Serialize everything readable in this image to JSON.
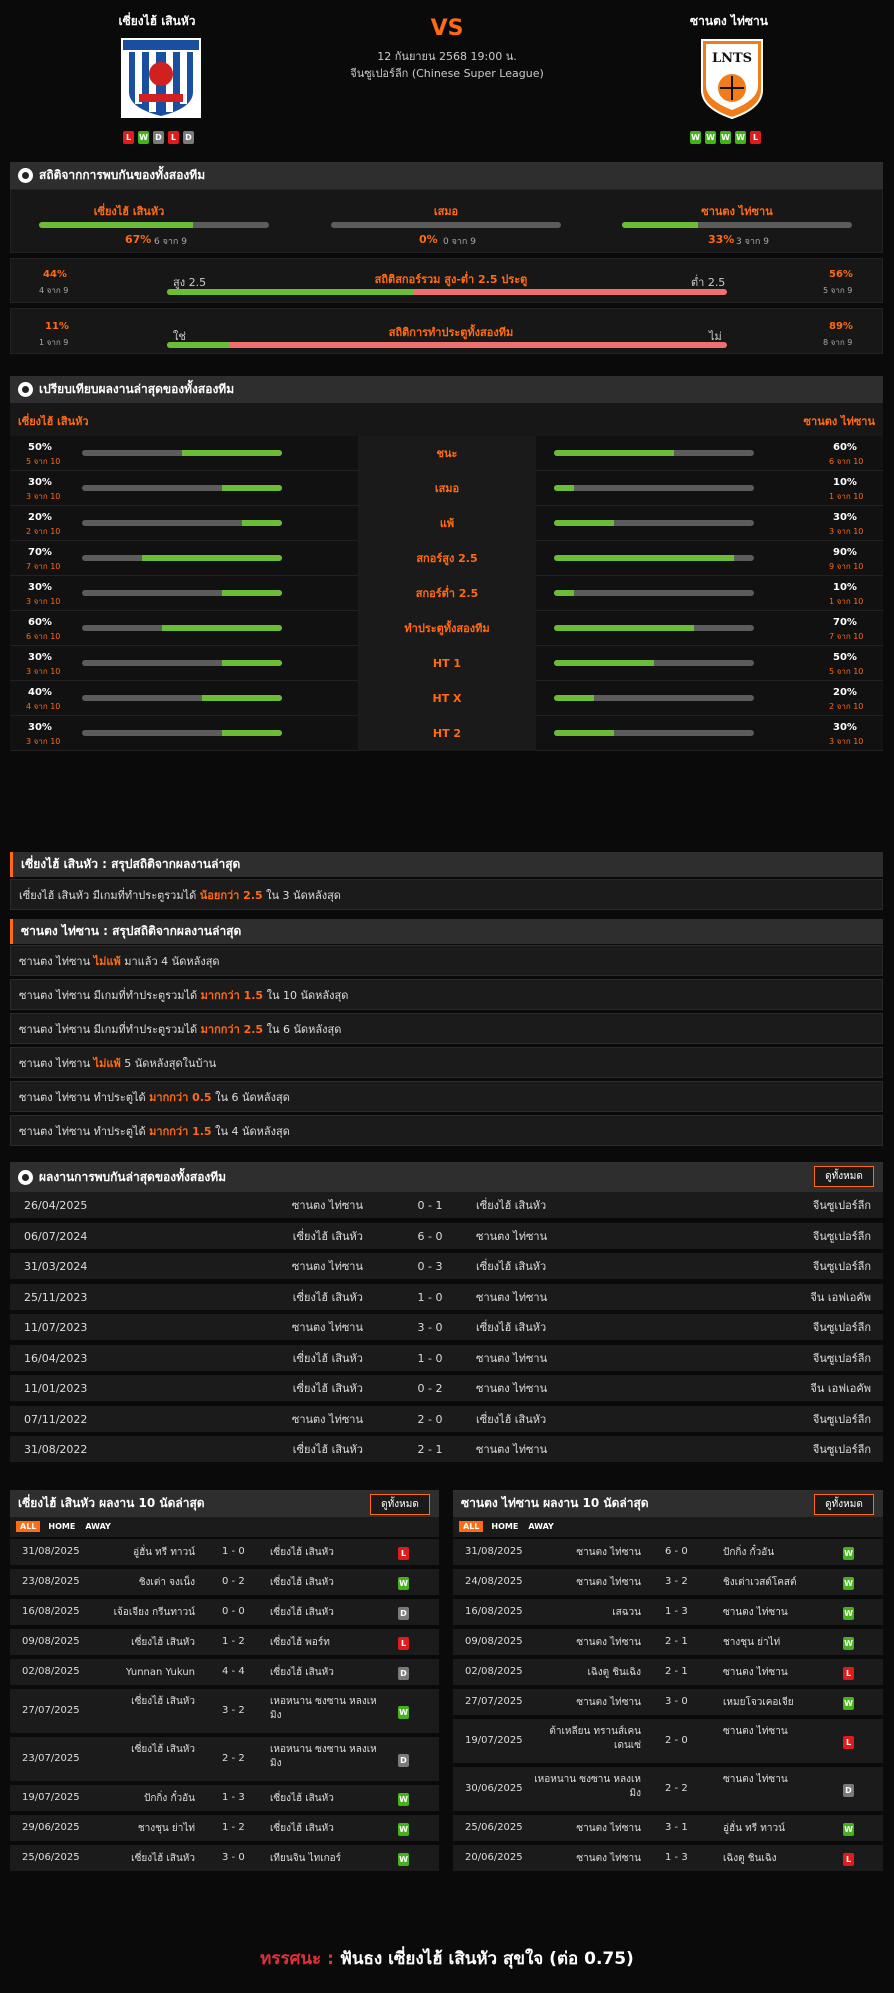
{
  "match": {
    "home": "เซี่ยงไฮ้ เสินหัว",
    "away": "ซานตง ไท่ซาน",
    "vs": "VS",
    "datetime": "12 กันยายน 2568 19:00 น.",
    "league": "จีนซูเปอร์ลีก (Chinese Super League)",
    "home_form": [
      "L",
      "W",
      "D",
      "L",
      "D"
    ],
    "away_form": [
      "W",
      "W",
      "W",
      "W",
      "L"
    ]
  },
  "h2h_stats": {
    "title": "สถิติจากการพบกันของทั้งสองทีม",
    "home_label": "เซี่ยงไฮ้ เสินหัว",
    "home_pct": "67%",
    "home_sub": "6 จาก 9",
    "home_frac": 0.67,
    "draw_label": "เสมอ",
    "draw_pct": "0%",
    "draw_sub": "0 จาก 9",
    "draw_frac": 0,
    "away_label": "ซานตง ไท่ซาน",
    "away_pct": "33%",
    "away_sub": "3 จาก 9",
    "away_frac": 0.33,
    "ou_title": "สถิติสกอร์รวม สูง-ต่ำ 2.5 ประตู",
    "ou_left_pct": "44%",
    "ou_left_sub": "4 จาก 9",
    "ou_left_label": "สูง 2.5",
    "ou_right_pct": "56%",
    "ou_right_sub": "5 จาก 9",
    "ou_right_label": "ต่ำ 2.5",
    "ou_frac": 0.44,
    "bt_title": "สถิติการทำประตูทั้งสองทีม",
    "bt_left_pct": "11%",
    "bt_left_sub": "1 จาก 9",
    "bt_left_label": "ใช่",
    "bt_right_pct": "89%",
    "bt_right_sub": "8 จาก 9",
    "bt_right_label": "ไม่",
    "bt_frac": 0.11
  },
  "compare": {
    "title": "เปรียบเทียบผลงานล่าสุดของทั้งสองทีม",
    "home": "เซี่ยงไฮ้ เสินหัว",
    "away": "ซานตง ไท่ซาน",
    "rows": [
      {
        "label": "ชนะ",
        "hp": "50%",
        "hs": "5 จาก 10",
        "hf": 0.5,
        "ap": "60%",
        "as": "6 จาก 10",
        "af": 0.6
      },
      {
        "label": "เสมอ",
        "hp": "30%",
        "hs": "3 จาก 10",
        "hf": 0.3,
        "ap": "10%",
        "as": "1 จาก 10",
        "af": 0.1
      },
      {
        "label": "แพ้",
        "hp": "20%",
        "hs": "2 จาก 10",
        "hf": 0.2,
        "ap": "30%",
        "as": "3 จาก 10",
        "af": 0.3
      },
      {
        "label": "สกอร์สูง 2.5",
        "hp": "70%",
        "hs": "7 จาก 10",
        "hf": 0.7,
        "ap": "90%",
        "as": "9 จาก 10",
        "af": 0.9
      },
      {
        "label": "สกอร์ต่ำ 2.5",
        "hp": "30%",
        "hs": "3 จาก 10",
        "hf": 0.3,
        "ap": "10%",
        "as": "1 จาก 10",
        "af": 0.1
      },
      {
        "label": "ทำประตูทั้งสองทีม",
        "hp": "60%",
        "hs": "6 จาก 10",
        "hf": 0.6,
        "ap": "70%",
        "as": "7 จาก 10",
        "af": 0.7
      },
      {
        "label": "HT 1",
        "hp": "30%",
        "hs": "3 จาก 10",
        "hf": 0.3,
        "ap": "50%",
        "as": "5 จาก 10",
        "af": 0.5
      },
      {
        "label": "HT X",
        "hp": "40%",
        "hs": "4 จาก 10",
        "hf": 0.4,
        "ap": "20%",
        "as": "2 จาก 10",
        "af": 0.2
      },
      {
        "label": "HT 2",
        "hp": "30%",
        "hs": "3 จาก 10",
        "hf": 0.3,
        "ap": "30%",
        "as": "3 จาก 10",
        "af": 0.3
      }
    ]
  },
  "home_summary": {
    "title": "เซี่ยงไฮ้ เสินหัว : สรุปสถิติจากผลงานล่าสุด",
    "rows": [
      {
        "a": "เซี่ยงไฮ้ เสินหัว  มีเกมที่ทำประตูรวมได้ ",
        "b": "น้อยกว่า  2.5",
        "c": "  ใน 3 นัดหลังสุด"
      }
    ]
  },
  "away_summary": {
    "title": "ซานตง ไท่ซาน : สรุปสถิติจากผลงานล่าสุด",
    "rows": [
      {
        "a": "ซานตง ไท่ซาน ",
        "b": "ไม่แพ้",
        "c": " มาแล้ว 4 นัดหลังสุด"
      },
      {
        "a": "ซานตง ไท่ซาน  มีเกมที่ทำประตูรวมได้ ",
        "b": "มากกว่า  1.5",
        "c": "  ใน 10 นัดหลังสุด"
      },
      {
        "a": "ซานตง ไท่ซาน  มีเกมที่ทำประตูรวมได้ ",
        "b": "มากกว่า  2.5",
        "c": "  ใน 6 นัดหลังสุด"
      },
      {
        "a": "ซานตง ไท่ซาน ",
        "b": "ไม่แพ้",
        "c": "  5  นัดหลังสุดในบ้าน"
      },
      {
        "a": "ซานตง ไท่ซาน  ทำประตูได้ ",
        "b": "มากกว่า  0.5",
        "c": "  ใน 6 นัดหลังสุด"
      },
      {
        "a": "ซานตง ไท่ซาน  ทำประตูได้ ",
        "b": "มากกว่า  1.5",
        "c": "  ใน 4 นัดหลังสุด"
      }
    ]
  },
  "h2h_results": {
    "title": "ผลงานการพบกันล่าสุดของทั้งสองทีม",
    "view_all": "ดูทั้งหมด",
    "rows": [
      {
        "date": "26/04/2025",
        "home": "ซานตง ไท่ซาน",
        "score": "0 - 1",
        "away": "เซี่ยงไฮ้ เสินหัว",
        "comp": "จีนซูเปอร์ลีก"
      },
      {
        "date": "06/07/2024",
        "home": "เซี่ยงไฮ้ เสินหัว",
        "score": "6 - 0",
        "away": "ซานตง ไท่ซาน",
        "comp": "จีนซูเปอร์ลีก"
      },
      {
        "date": "31/03/2024",
        "home": "ซานตง ไท่ซาน",
        "score": "0 - 3",
        "away": "เซี่ยงไฮ้ เสินหัว",
        "comp": "จีนซูเปอร์ลีก"
      },
      {
        "date": "25/11/2023",
        "home": "เซี่ยงไฮ้ เสินหัว",
        "score": "1 - 0",
        "away": "ซานตง ไท่ซาน",
        "comp": "จีน เอฟเอคัพ"
      },
      {
        "date": "11/07/2023",
        "home": "ซานตง ไท่ซาน",
        "score": "3 - 0",
        "away": "เซี่ยงไฮ้ เสินหัว",
        "comp": "จีนซูเปอร์ลีก"
      },
      {
        "date": "16/04/2023",
        "home": "เซี่ยงไฮ้ เสินหัว",
        "score": "1 - 0",
        "away": "ซานตง ไท่ซาน",
        "comp": "จีนซูเปอร์ลีก"
      },
      {
        "date": "11/01/2023",
        "home": "เซี่ยงไฮ้ เสินหัว",
        "score": "0 - 2",
        "away": "ซานตง ไท่ซาน",
        "comp": "จีน เอฟเอคัพ"
      },
      {
        "date": "07/11/2022",
        "home": "ซานตง ไท่ซาน",
        "score": "2 - 0",
        "away": "เซี่ยงไฮ้ เสินหัว",
        "comp": "จีนซูเปอร์ลีก"
      },
      {
        "date": "31/08/2022",
        "home": "เซี่ยงไฮ้ เสินหัว",
        "score": "2 - 1",
        "away": "ซานตง ไท่ซาน",
        "comp": "จีนซูเปอร์ลีก"
      }
    ]
  },
  "home_last10": {
    "title": "เซี่ยงไฮ้ เสินหัว ผลงาน 10 นัดล่าสุด",
    "view_all": "ดูทั้งหมด",
    "tabs": [
      "ALL",
      "HOME",
      "AWAY"
    ],
    "rows": [
      {
        "date": "31/08/2025",
        "home": "อู่ฮั่น ทรี ทาวน์",
        "score": "1 - 0",
        "away": "เซี่ยงไฮ้ เสินหัว",
        "r": "L"
      },
      {
        "date": "23/08/2025",
        "home": "ชิงเต่า จงเน็ง",
        "score": "0 - 2",
        "away": "เซี่ยงไฮ้ เสินหัว",
        "r": "W"
      },
      {
        "date": "16/08/2025",
        "home": "เจ้อเจียง กรีนทาวน์",
        "score": "0 - 0",
        "away": "เซี่ยงไฮ้ เสินหัว",
        "r": "D"
      },
      {
        "date": "09/08/2025",
        "home": "เซี่ยงไฮ้ เสินหัว",
        "score": "1 - 2",
        "away": "เซี่ยงไฮ้ พอร์ท",
        "r": "L"
      },
      {
        "date": "02/08/2025",
        "home": "Yunnan Yukun",
        "score": "4 - 4",
        "away": "เซี่ยงไฮ้ เสินหัว",
        "r": "D"
      },
      {
        "date": "27/07/2025",
        "home": "เซี่ยงไฮ้ เสินหัว",
        "score": "3 - 2",
        "away": "เหอหนาน ซงซาน หลงเหมิง",
        "r": "W"
      },
      {
        "date": "23/07/2025",
        "home": "เซี่ยงไฮ้ เสินหัว",
        "score": "2 - 2",
        "away": "เหอหนาน ซงซาน หลงเหมิง",
        "r": "D"
      },
      {
        "date": "19/07/2025",
        "home": "ปักกิ่ง กั๋วอัน",
        "score": "1 - 3",
        "away": "เซี่ยงไฮ้ เสินหัว",
        "r": "W"
      },
      {
        "date": "29/06/2025",
        "home": "ชางชุน ย่าไท่",
        "score": "1 - 2",
        "away": "เซี่ยงไฮ้ เสินหัว",
        "r": "W"
      },
      {
        "date": "25/06/2025",
        "home": "เซี่ยงไฮ้ เสินหัว",
        "score": "3 - 0",
        "away": "เทียนจิน ไทเกอร์",
        "r": "W"
      }
    ]
  },
  "away_last10": {
    "title": "ซานตง ไท่ซาน ผลงาน 10 นัดล่าสุด",
    "view_all": "ดูทั้งหมด",
    "tabs": [
      "ALL",
      "HOME",
      "AWAY"
    ],
    "rows": [
      {
        "date": "31/08/2025",
        "home": "ซานตง ไท่ซาน",
        "score": "6 - 0",
        "away": "ปักกิ่ง กั๋วอัน",
        "r": "W"
      },
      {
        "date": "24/08/2025",
        "home": "ซานตง ไท่ซาน",
        "score": "3 - 2",
        "away": "ชิงเต่าเวสต์โคสต์",
        "r": "W"
      },
      {
        "date": "16/08/2025",
        "home": "เสฉวน",
        "score": "1 - 3",
        "away": "ซานตง ไท่ซาน",
        "r": "W"
      },
      {
        "date": "09/08/2025",
        "home": "ซานตง ไท่ซาน",
        "score": "2 - 1",
        "away": "ชางชุน ย่าไท่",
        "r": "W"
      },
      {
        "date": "02/08/2025",
        "home": "เฉิงตู ชินเฉิง",
        "score": "2 - 1",
        "away": "ซานตง ไท่ซาน",
        "r": "L"
      },
      {
        "date": "27/07/2025",
        "home": "ซานตง ไท่ซาน",
        "score": "3 - 0",
        "away": "เหมยโจวเคอเจีย",
        "r": "W"
      },
      {
        "date": "19/07/2025",
        "home": "ต้าเหลียน ทรานส์เคน เดนเซ่",
        "score": "2 - 0",
        "away": "ซานตง ไท่ซาน",
        "r": "L"
      },
      {
        "date": "30/06/2025",
        "home": "เหอหนาน ซงซาน หลงเหมิง",
        "score": "2 - 2",
        "away": "ซานตง ไท่ซาน",
        "r": "D"
      },
      {
        "date": "25/06/2025",
        "home": "ซานตง ไท่ซาน",
        "score": "3 - 1",
        "away": "อู่ฮั่น ทรี ทาวน์",
        "r": "W"
      },
      {
        "date": "20/06/2025",
        "home": "ซานตง ไท่ซาน",
        "score": "1 - 3",
        "away": "เฉิงตู ชินเฉิง",
        "r": "L"
      }
    ]
  },
  "prediction": {
    "label": "ทรรศนะ :",
    "text": "ฟันธง เซี่ยงไฮ้ เสินหัว สุขใจ (ต่อ 0.75)"
  },
  "colors": {
    "accent": "#ff6a13",
    "win": "#44b31a",
    "loss": "#e01b1b",
    "draw": "#7a7a7a",
    "bar_green": "#6bbd36",
    "bar_red": "#f07070"
  }
}
